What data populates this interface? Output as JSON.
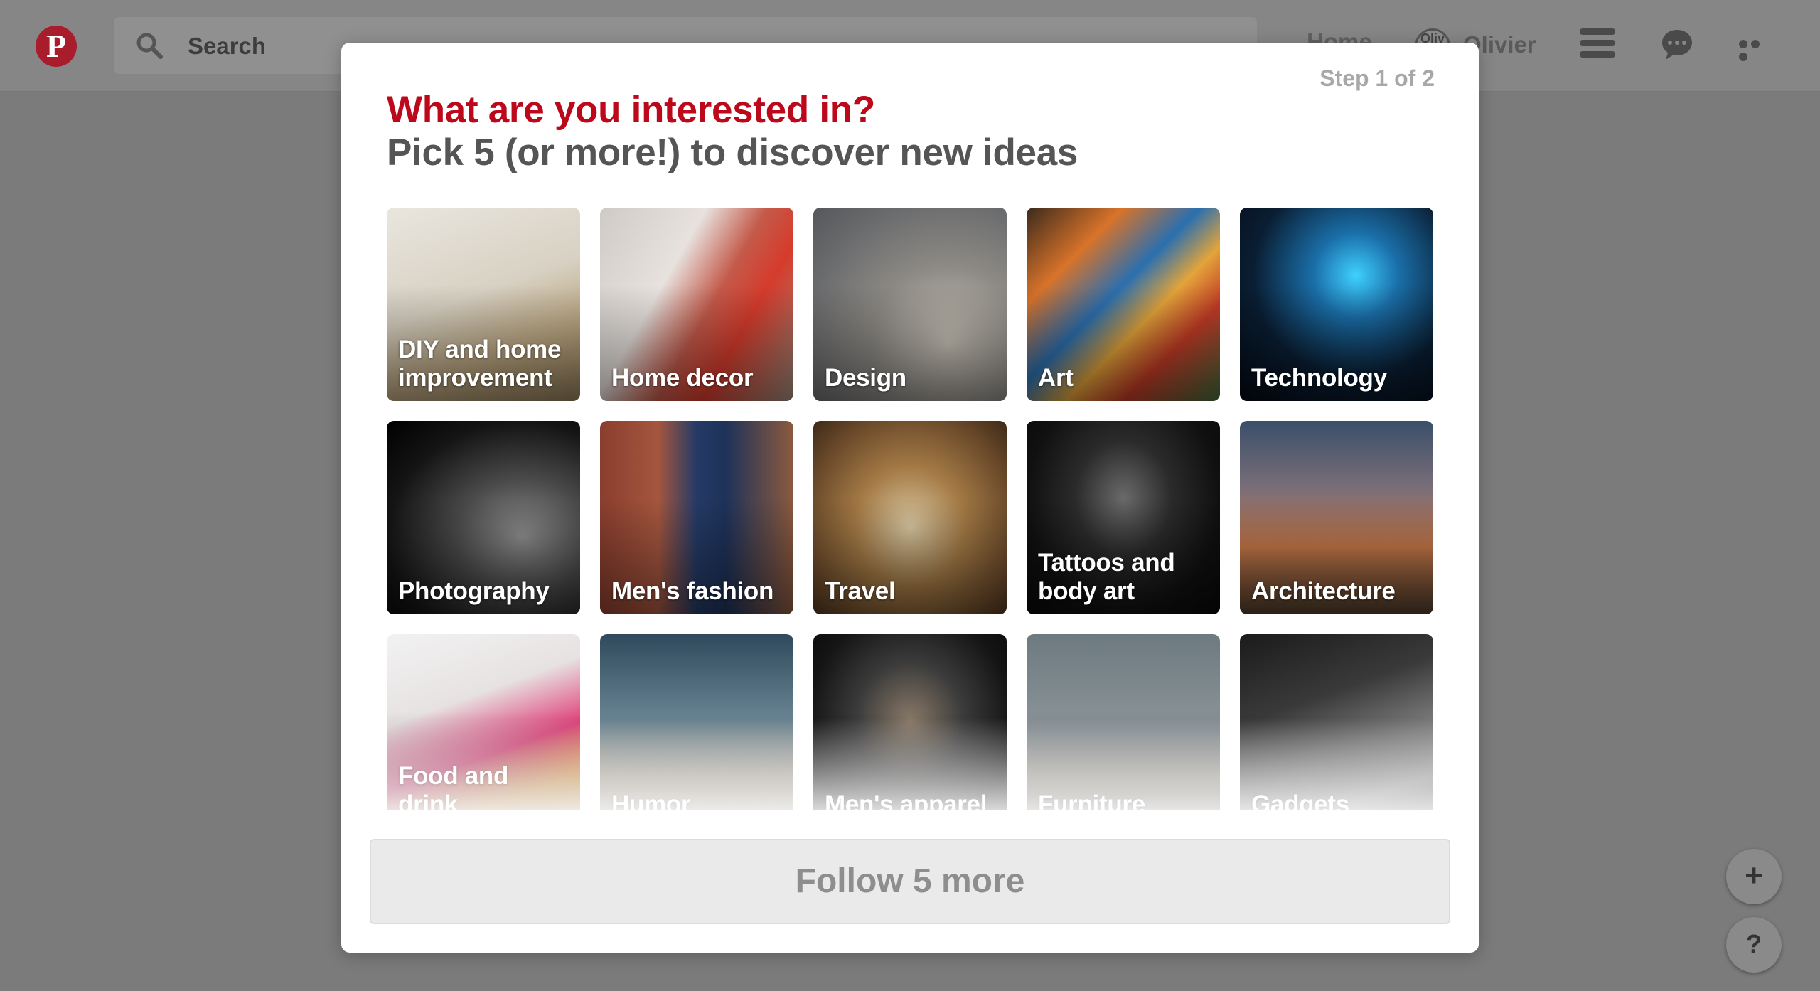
{
  "header": {
    "search_label": "Search",
    "nav_home": "Home",
    "user_avatar_text": "Oliv",
    "user_name": "Olivier"
  },
  "modal": {
    "step": "Step 1 of 2",
    "title": "What are you interested in?",
    "subtitle": "Pick 5 (or more!) to discover new ideas",
    "topics": [
      {
        "label": "DIY and home improvement"
      },
      {
        "label": "Home decor"
      },
      {
        "label": "Design"
      },
      {
        "label": "Art"
      },
      {
        "label": "Technology"
      },
      {
        "label": "Photography"
      },
      {
        "label": "Men's fashion"
      },
      {
        "label": "Travel"
      },
      {
        "label": "Tattoos and body art"
      },
      {
        "label": "Architecture"
      },
      {
        "label": "Food and drink"
      },
      {
        "label": "Humor"
      },
      {
        "label": "Men's apparel"
      },
      {
        "label": "Furniture"
      },
      {
        "label": "Gadgets"
      }
    ],
    "follow_button": "Follow 5 more"
  },
  "fab": {
    "plus": "+",
    "help": "?"
  },
  "colors": {
    "brand": "#bd081c",
    "subtitle": "#555555",
    "overlay": "#7b7b7b"
  }
}
